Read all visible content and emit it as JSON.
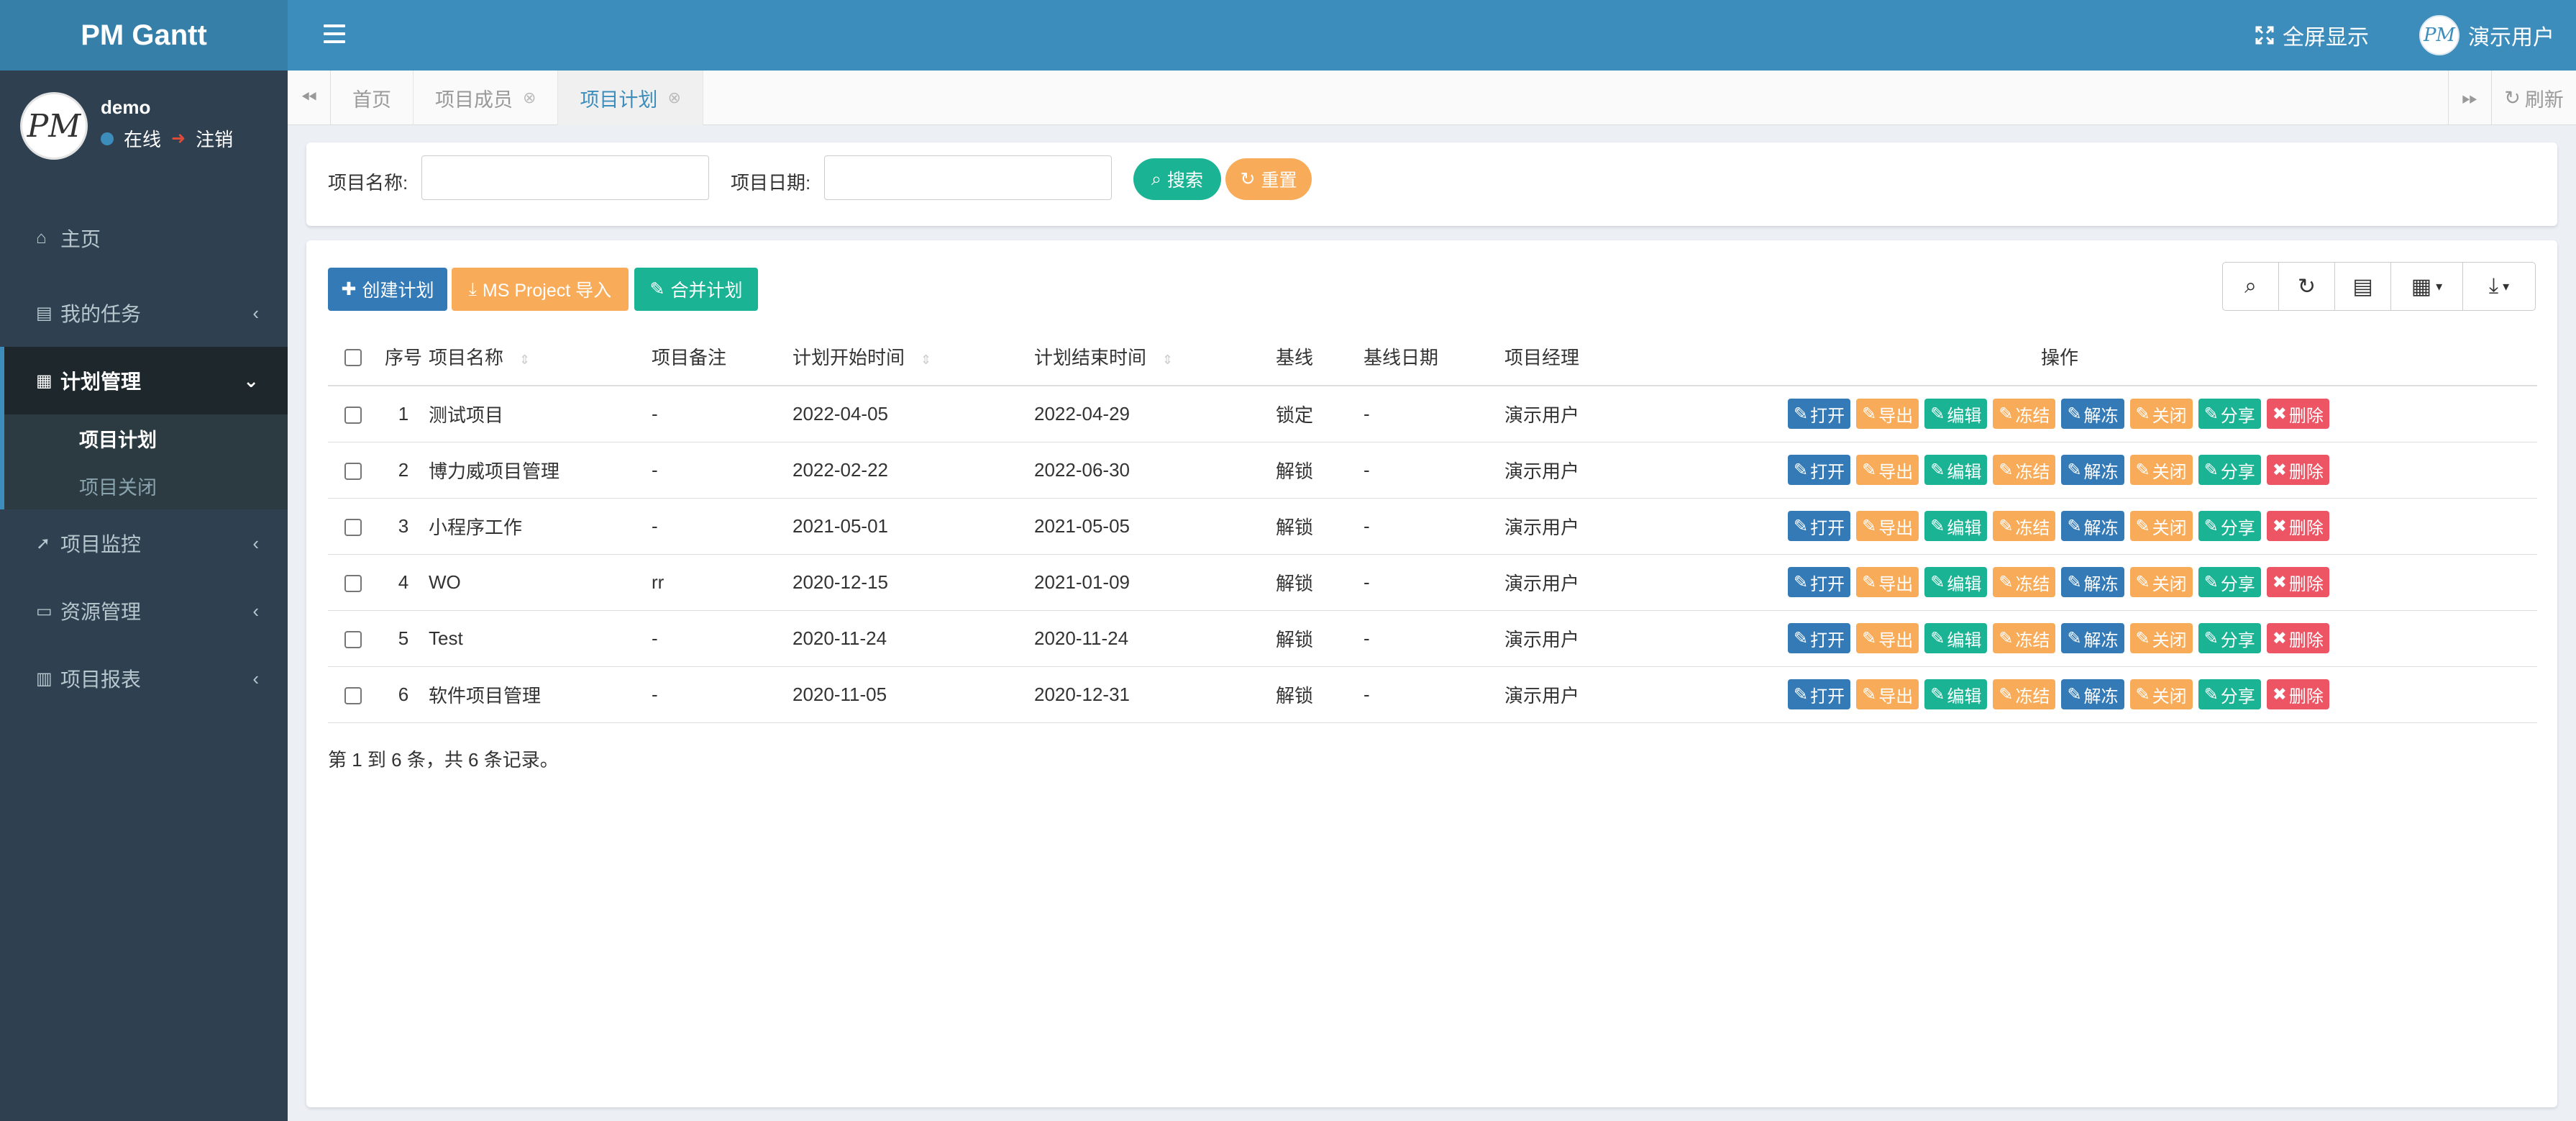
{
  "app": {
    "logo": "PM Gantt"
  },
  "navbar": {
    "fullscreen_label": "全屏显示",
    "avatar_text": "PM",
    "user_label": "演示用户"
  },
  "sidebar": {
    "avatar_text": "PM",
    "user_name": "demo",
    "status_online": "在线",
    "status_logout": "注销",
    "items": [
      {
        "label": "主页",
        "icon": "home-icon"
      },
      {
        "label": "我的任务",
        "icon": "task-icon"
      },
      {
        "label": "计划管理",
        "icon": "calendar-icon"
      },
      {
        "label": "项目监控",
        "icon": "paper-plane-icon"
      },
      {
        "label": "资源管理",
        "icon": "resource-icon"
      },
      {
        "label": "项目报表",
        "icon": "chart-icon"
      }
    ],
    "sub_items": [
      {
        "label": "项目计划"
      },
      {
        "label": "项目关闭"
      }
    ]
  },
  "tabs": {
    "items": [
      {
        "label": "首页"
      },
      {
        "label": "项目成员"
      },
      {
        "label": "项目计划"
      }
    ],
    "refresh_label": "刷新"
  },
  "search": {
    "name_label": "项目名称:",
    "date_label": "项目日期:",
    "name_value": "",
    "date_value": "",
    "search_button": "搜索",
    "reset_button": "重置"
  },
  "toolbar": {
    "create_label": "创建计划",
    "import_label": "MS Project 导入",
    "merge_label": "合并计划"
  },
  "table": {
    "headers": {
      "no": "序号",
      "name": "项目名称",
      "remark": "项目备注",
      "start": "计划开始时间",
      "end": "计划结束时间",
      "baseline": "基线",
      "baseline_date": "基线日期",
      "manager": "项目经理",
      "ops": "操作"
    },
    "actions": [
      "打开",
      "导出",
      "编辑",
      "冻结",
      "解冻",
      "关闭",
      "分享",
      "删除"
    ],
    "rows": [
      {
        "no": "1",
        "name": "测试项目",
        "remark": "-",
        "start": "2022-04-05",
        "end": "2022-04-29",
        "baseline": "锁定",
        "baseline_date": "-",
        "manager": "演示用户"
      },
      {
        "no": "2",
        "name": "博力威项目管理",
        "remark": "-",
        "start": "2022-02-22",
        "end": "2022-06-30",
        "baseline": "解锁",
        "baseline_date": "-",
        "manager": "演示用户"
      },
      {
        "no": "3",
        "name": "小程序工作",
        "remark": "-",
        "start": "2021-05-01",
        "end": "2021-05-05",
        "baseline": "解锁",
        "baseline_date": "-",
        "manager": "演示用户"
      },
      {
        "no": "4",
        "name": "WO",
        "remark": "rr",
        "start": "2020-12-15",
        "end": "2021-01-09",
        "baseline": "解锁",
        "baseline_date": "-",
        "manager": "演示用户"
      },
      {
        "no": "5",
        "name": "Test",
        "remark": "-",
        "start": "2020-11-24",
        "end": "2020-11-24",
        "baseline": "解锁",
        "baseline_date": "-",
        "manager": "演示用户"
      },
      {
        "no": "6",
        "name": "软件项目管理",
        "remark": "-",
        "start": "2020-11-05",
        "end": "2020-12-31",
        "baseline": "解锁",
        "baseline_date": "-",
        "manager": "演示用户"
      }
    ],
    "footer": "第 1 到 6 条，共 6 条记录。"
  },
  "colors": {
    "header": "#3c8dbc",
    "logo_bg": "#367fa9",
    "sidebar": "#2f4050",
    "btn_blue": "#337ab7",
    "btn_orange": "#f8ac59",
    "btn_green": "#1ab394",
    "btn_red": "#ed5565"
  }
}
